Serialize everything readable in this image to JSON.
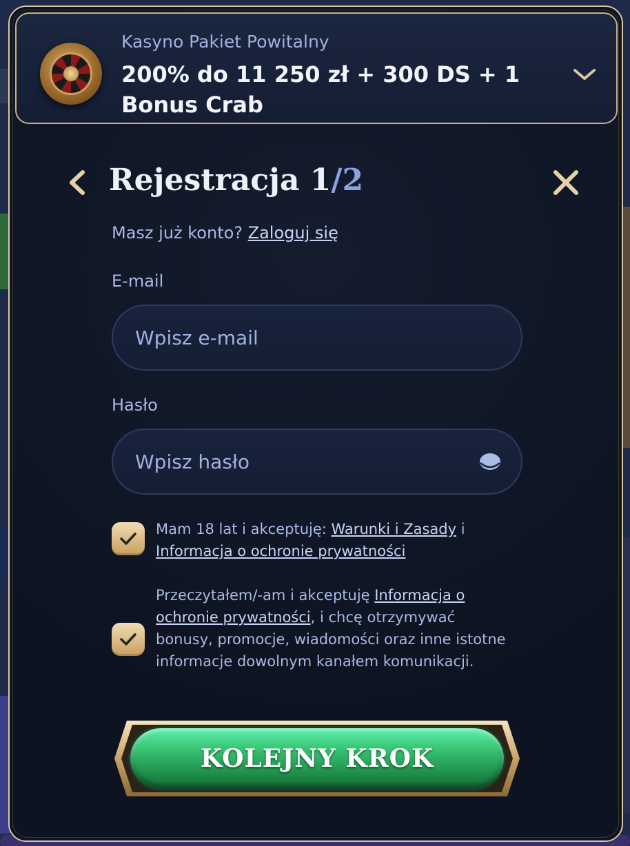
{
  "promo": {
    "subtitle": "Kasyno Pakiet Powitalny",
    "title": "200% do 11 250 zł + 300 DS + 1 Bonus Crab",
    "icon": "roulette-icon"
  },
  "registration": {
    "title_prefix": "Rejestracja 1",
    "title_suffix": "/2",
    "have_account_text": "Masz już konto? ",
    "login_link": "Zaloguj się"
  },
  "email": {
    "label": "E-mail",
    "placeholder": "Wpisz e-mail",
    "value": ""
  },
  "password": {
    "label": "Hasło",
    "placeholder": "Wpisz hasło",
    "value": ""
  },
  "consents": [
    {
      "checked": true,
      "text_before": "Mam 18 lat i akceptuję: ",
      "link1": "Warunki i Zasady",
      "text_mid": " i ",
      "link2": "Informacja o ochronie prywatności",
      "text_after": ""
    },
    {
      "checked": true,
      "text_before": "Przeczytałem/-am i akceptuję ",
      "link1": "Informacja o ochronie prywatności",
      "text_after": ", i chcę otrzymywać bonusy, promocje, wiadomości oraz inne istotne informacje dowolnym kanałem komunikacji."
    }
  ],
  "next_button": {
    "label": "KOLEJNY KROK"
  },
  "colors": {
    "accent_gold": "#d9c7a2",
    "button_green": "#3cc97a",
    "text_muted": "#a9b9e6",
    "step_total": "#8aa3e0"
  }
}
